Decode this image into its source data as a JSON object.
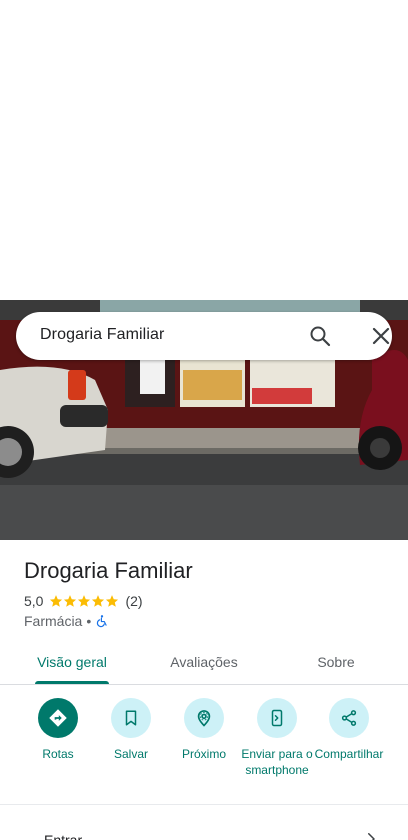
{
  "search": {
    "query": "Drogaria Familiar"
  },
  "place": {
    "name": "Drogaria Familiar",
    "rating": "5,0",
    "stars": 5,
    "review_count": "(2)",
    "category": "Farmácia",
    "separator": "•",
    "accessibility_icon": "wheelchair-icon"
  },
  "tabs": [
    {
      "label": "Visão geral",
      "active": true
    },
    {
      "label": "Avaliações",
      "active": false
    },
    {
      "label": "Sobre",
      "active": false
    }
  ],
  "actions": [
    {
      "label": "Rotas",
      "icon": "directions-icon"
    },
    {
      "label": "Salvar",
      "icon": "bookmark-icon"
    },
    {
      "label": "Próximo",
      "icon": "nearby-icon"
    },
    {
      "label": "Enviar para o smartphone",
      "icon": "send-to-phone-icon"
    },
    {
      "label": "Compartilhar",
      "icon": "share-icon"
    }
  ],
  "bottom": {
    "text": "Entrar"
  },
  "colors": {
    "accent": "#00796b",
    "action_bg": "#cdf1f7",
    "star": "#fbbc04"
  }
}
